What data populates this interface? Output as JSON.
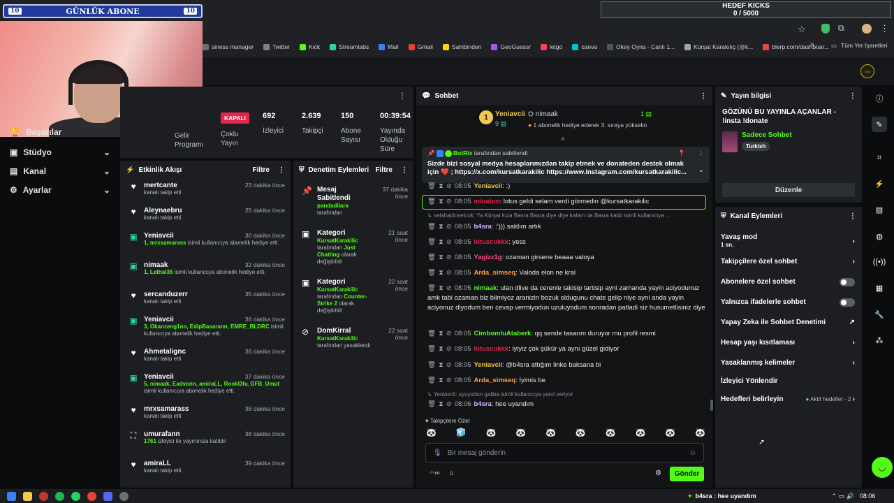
{
  "overlay": {
    "abone_left": "10",
    "abone_title": "GÜNLÜK ABONE",
    "abone_right": "10",
    "kicks_title": "HEDEF KICKS",
    "kicks_value": "0 / 5000"
  },
  "bookmarks": [
    {
      "label": "siness manager",
      "color": "#6b6f74"
    },
    {
      "label": "Twitter",
      "color": "#7d8085"
    },
    {
      "label": "Kick",
      "color": "#53fc18"
    },
    {
      "label": "Streamlabs",
      "color": "#2fd3a4"
    },
    {
      "label": "Mail",
      "color": "#3b82f6"
    },
    {
      "label": "Gmail",
      "color": "#ea4335"
    },
    {
      "label": "Sahibinden",
      "color": "#ffd500"
    },
    {
      "label": "GeoGuessr",
      "color": "#a855f7"
    },
    {
      "label": "letgo",
      "color": "#ff3f55"
    },
    {
      "label": "canva",
      "color": "#00c4cc"
    },
    {
      "label": "Okey Oyna - Canlı 1...",
      "color": "#4b5563"
    },
    {
      "label": "Kürşat Karakılıç (@k...",
      "color": "#9ca3af"
    },
    {
      "label": "blerp.com/dashboar...",
      "color": "#ef4444"
    }
  ],
  "bookmarks_folder": "Tüm Yer İşaretleri",
  "sidebar": {
    "items": [
      {
        "label": "Başarılar"
      },
      {
        "label": "Stüdyo"
      },
      {
        "label": "Kanal"
      },
      {
        "label": "Ayarlar"
      }
    ]
  },
  "stats": {
    "partial_label": "Gelir Programı",
    "status_badge": "KAPALI",
    "status_label": "Çoklu Yayın",
    "viewers_value": "692",
    "viewers_label": "İzleyici",
    "followers_value": "2.639",
    "followers_label": "Takipçi",
    "subs_value": "150",
    "subs_label": "Abone Sayısı",
    "uptime_value": "00:39:54",
    "uptime_label": "Yayında Olduğu Süre"
  },
  "activity": {
    "title": "Etkinlik Akışı",
    "filter": "Filtre",
    "items": [
      {
        "name": "mertcante",
        "time": "23 dakika önce",
        "desc": "kanalı takip etti",
        "names": "",
        "icon": "heart"
      },
      {
        "name": "Aleynaebru",
        "time": "25 dakika önce",
        "desc": "kanalı takip etti",
        "names": "",
        "icon": "heart"
      },
      {
        "name": "Yeniavcii",
        "time": "30 dakika önce",
        "names": "1, mrxsamarass",
        "desc": " isimli kullanıcıya abonelik hediye etti.",
        "icon": "gift"
      },
      {
        "name": "nimaak",
        "time": "32 dakika önce",
        "names": "1, Lethal35",
        "desc": " isimli kullanıcıya abonelik hediye etti.",
        "icon": "gift"
      },
      {
        "name": "sercanduzerr",
        "time": "35 dakika önce",
        "desc": "kanalı takip etti",
        "names": "",
        "icon": "heart"
      },
      {
        "name": "Yeniavcii",
        "time": "36 dakika önce",
        "names": "3, Okanzeng1nn, EdipBasarann, EMRE_BLDRC",
        "desc": " isimli kullanıcıya abonelik hediye etti.",
        "icon": "gift"
      },
      {
        "name": "Ahmetalignc",
        "time": "36 dakika önce",
        "desc": "kanalı takip etti",
        "names": "",
        "icon": "heart"
      },
      {
        "name": "Yeniavcii",
        "time": "37 dakika önce",
        "names": "5, nimaak, Eadvonn, amiraLL, Rookl3tv, GFB_Umut",
        "desc": " isimli kullanıcıya abonelik hediye etti.",
        "icon": "gift"
      },
      {
        "name": "mrxsamarass",
        "time": "38 dakika önce",
        "desc": "kanalı takip etti",
        "names": "",
        "icon": "heart"
      },
      {
        "name": "umurafann",
        "time": "38 dakika önce",
        "names": "1761",
        "desc": " izleyici ile yayınınıza katıldı!",
        "icon": "raid"
      },
      {
        "name": "amiraLL",
        "time": "39 dakika önce",
        "desc": "kanalı takip etti",
        "names": "",
        "icon": "heart"
      }
    ]
  },
  "moderation": {
    "title": "Denetim Eylemleri",
    "filter": "Filtre",
    "items": [
      {
        "title": "Mesaj Sabitlendi",
        "time": "37 dakika önce",
        "who": "pandadilara",
        "rest": " tarafından",
        "extra": "",
        "tail": "",
        "icon": "pin"
      },
      {
        "title": "Kategori",
        "time": "21 saat önce",
        "who": "KursatKarakilic",
        "rest": " tarafından ",
        "extra": "Just Chatting",
        "tail": " olarak değiştirildi",
        "icon": "cat"
      },
      {
        "title": "Kategori",
        "time": "22 saat önce",
        "who": "KursatKarakilic",
        "rest": " tarafından ",
        "extra": "Counter-Strike 2",
        "tail": " olarak değiştirildi",
        "icon": "cat"
      },
      {
        "title": "DomKirral",
        "time": "22 saat önce",
        "who": "KursatKarakilic",
        "rest": " tarafından yasaklandı",
        "extra": "",
        "tail": "",
        "icon": "ban"
      }
    ]
  },
  "chat": {
    "title": "Sohbet",
    "top_gifter_1": "Yeniavcii",
    "top_gifter_1_count": "9",
    "top_gifter_2": "nimaak",
    "top_gifter_2_count": "1",
    "top_gifter_2_text": "1 abonelik hediye ederek 3. sıraya yükselin",
    "rank": "1",
    "pinned_by": "BotRix",
    "pinned_by_suffix": "tarafından sabitlendi",
    "pinned_text": "Sizde bizi sosyal medya hesaplarımızdan takip etmek ve donateden destek olmak için ❤️ ; https://x.com/kursatkarakilic https://www.instagram.com/kursatkarakilic...",
    "messages": [
      {
        "time": "08:05",
        "user": "Yeniavcii",
        "color": "#f2c94c",
        "text": ": :)"
      },
      {
        "time": "08:05",
        "user": "minatoo",
        "color": "#e8234a",
        "text": ": lotus geldi selam verdi görmedin @kursatkarakilic"
      },
      {
        "reply": "selahattinselcuk: Ya Kürşat kıza Basra Basra diye diye kafam da Basra kaldı  isimli kullanıcıya ..."
      },
      {
        "time": "08:05",
        "user": "b4sra",
        "color": "#d6b3ff",
        "text": ": :'))) saldım artık"
      },
      {
        "time": "08:05",
        "user": "lotuscukkk",
        "color": "#e8234a",
        "text": ": yess"
      },
      {
        "time": "08:05",
        "user": "Yagizz1g",
        "color": "#ff4f8b",
        "text": ": ozaman girsene beaaa valoya"
      },
      {
        "time": "08:05",
        "user": "Arda_simseq",
        "color": "#ff9f43",
        "text": ": Valoda elon ne kral"
      },
      {
        "time": "08:05",
        "user": "nimaak",
        "color": "#53fc18",
        "text": ": ulan dlive da cerenle takisip tartisip ayni zamanda yayin aciyodunuz amk tabi ozaman biz bilmiyoz aranizin bozuk oldugunu chate gelip niye ayni anda yayin aciyonuz diyodum ben cevap vermiyodun uzuluyodum sonradan patladi siz husumetlisiniz diye"
      },
      {
        "time": "08:05",
        "user": "CimbomluAtaberk",
        "color": "#53fc18",
        "text": ": qq sende tasarım duruyor mu profil resmi"
      },
      {
        "time": "08:05",
        "user": "lotuscukkk",
        "color": "#e8234a",
        "text": ": iyiyiz çok şükür ya aynı güzel gidiyor"
      },
      {
        "time": "08:05",
        "user": "Yeniavcii",
        "color": "#f2c94c",
        "text": ": @b4sra attığım linke baksana bi"
      },
      {
        "time": "08:05",
        "user": "Arda_simseq",
        "color": "#ff9f43",
        "text": ": İyimis be"
      },
      {
        "reply": "Yeniavcii: uyuyodun galiba isimli kullanıcıya yanıt veriyor"
      },
      {
        "time": "08:06",
        "user": "b4sra",
        "color": "#d6b3ff",
        "text": ": hee uyandım"
      }
    ],
    "followers_only": "Takipçilere Özel",
    "input_placeholder": "Bir mesaj gönderin",
    "send": "Gönder"
  },
  "stream_info": {
    "title": "Yayın bilgisi",
    "stream_title": "GÖZÜNÜ BU YAYINLA AÇANLAR - !insta !donate",
    "category": "Sadece Sohbet",
    "tag": "Turkish",
    "edit": "Düzenle"
  },
  "channel_actions": {
    "title": "Kanal Eylemleri",
    "slow_mode": "Yavaş mod",
    "slow_mode_value": "1 sn.",
    "followers_chat": "Takipçilere özel sohbet",
    "subs_chat": "Abonelere özel sohbet",
    "emotes_chat": "Yalnızca ifadelerle sohbet",
    "ai_mod": "Yapay Zeka ile Sohbet Denetimi",
    "age_limit": "Hesap yaşı kısıtlaması",
    "banned_words": "Yasaklanmış kelimeler",
    "redirect": "İzleyici Yönlendir",
    "goals": "Hedefleri belirleyin",
    "goals_status": "Aktif hedefler - 2"
  },
  "taskbar": {
    "chat_ticker": "b4sra : hee uyandım",
    "clock": "08:06"
  }
}
